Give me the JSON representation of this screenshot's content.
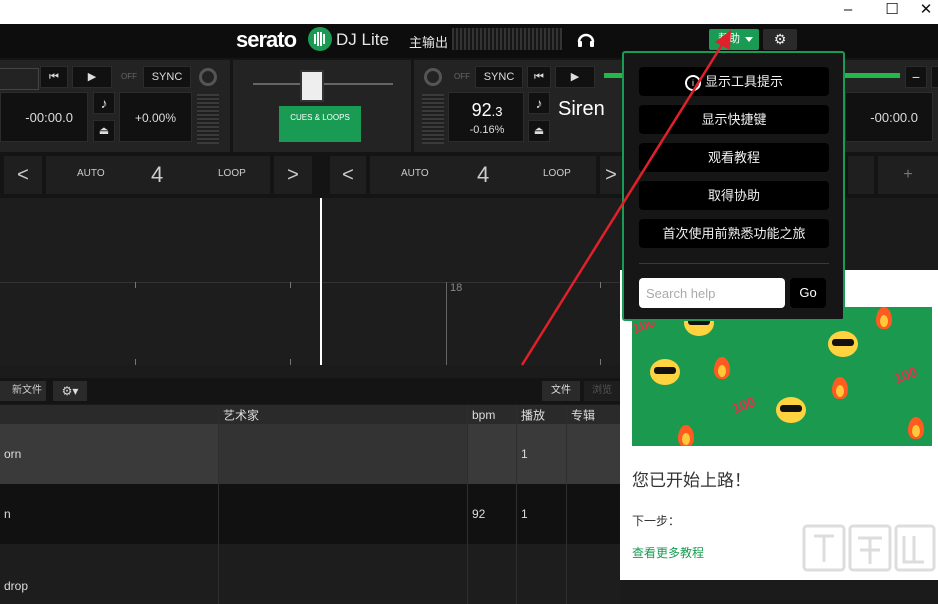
{
  "window": {
    "minimize": "–",
    "maximize": "☐",
    "close": "✕"
  },
  "app": {
    "brand": "serato",
    "product": "DJ Lite",
    "master_output_label": "主输出",
    "help_button": "帮助",
    "settings_icon": "gear-icon"
  },
  "deck_left": {
    "time": "-00:00.0",
    "pitch": "+0.00%",
    "sync": "SYNC",
    "off": "OFF",
    "cues_loops": "CUES & LOOPS",
    "loop_mode": "AUTO",
    "loop_value": "4",
    "loop_label": "LOOP"
  },
  "deck_right": {
    "bpm_main": "92",
    "bpm_decimal": ".3",
    "pitch": "-0.16%",
    "sync": "SYNC",
    "off": "OFF",
    "title": "Siren",
    "time": "-00:00.0",
    "loop_mode": "AUTO",
    "loop_value": "4",
    "loop_label": "LOOP"
  },
  "waveform": {
    "beat_marker": "18"
  },
  "library": {
    "new_file_btn": "新文件",
    "file_btn": "文件",
    "browse_btn": "浏览",
    "columns": {
      "artist": "艺术家",
      "bpm": "bpm",
      "plays": "播放",
      "album": "专辑"
    },
    "rows": [
      {
        "title": "orn",
        "artist": "",
        "bpm": "",
        "plays": "1",
        "album": ""
      },
      {
        "title": "n",
        "artist": "",
        "bpm": "92",
        "plays": "1",
        "album": ""
      },
      {
        "title": "drop",
        "artist": "",
        "bpm": "",
        "plays": "",
        "album": ""
      }
    ]
  },
  "help_menu": {
    "items": [
      "显示工具提示",
      "显示快捷键",
      "观看教程",
      "取得协助",
      "首次使用前熟悉功能之旅"
    ],
    "search_placeholder": "Search help",
    "go": "Go"
  },
  "side_panel": {
    "heading": "您已开始上路！",
    "next_step": "下一步：",
    "link": "查看更多教程",
    "add_button": "+"
  },
  "watermark": "下载吧",
  "colors": {
    "accent_green": "#1a9b54",
    "arrow_red": "#e0202a",
    "promo_green": "#1b9a4f"
  }
}
